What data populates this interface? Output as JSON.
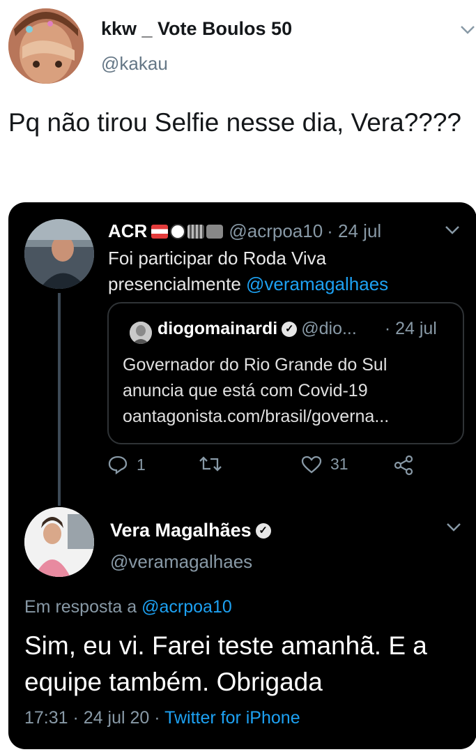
{
  "outer_tweet": {
    "display_name": "kkw _ Vote Boulos 50",
    "handle": "@kakau",
    "text": "Pq não tirou Selfie nesse dia, Vera????",
    "menu_icon": "chevron-down-icon"
  },
  "quoted_thread": {
    "parent": {
      "display_name": "ACR",
      "emojis": [
        "flag-austria",
        "soccer-ball",
        "flag-grid",
        "movie-camera"
      ],
      "handle": "@acrpoa10",
      "date": "· 24 jul",
      "text_prefix": "Foi participar do Roda Viva presencialmente ",
      "mention": "@veramagalhaes",
      "quote": {
        "display_name": "diogomainardi",
        "handle": "@dio...",
        "date": "· 24 jul",
        "text": "Governador do Rio Grande do Sul anuncia que está com Covid-19",
        "link": "oantagonista.com/brasil/governa..."
      },
      "actions": {
        "reply_count": "1",
        "retweet_count": "",
        "like_count": "31"
      }
    },
    "reply": {
      "display_name": "Vera Magalhães",
      "handle": "@veramagalhaes",
      "reply_prefix": "Em resposta a ",
      "reply_mention": "@acrpoa10",
      "text": "Sim, eu vi. Farei teste amanhã. E a equipe também. Obrigada",
      "time": "17:31 · 24 jul 20 · ",
      "source": "Twitter for iPhone"
    }
  },
  "colors": {
    "link": "#1da1f2",
    "muted": "#8899a6",
    "dark_bg": "#000000"
  }
}
